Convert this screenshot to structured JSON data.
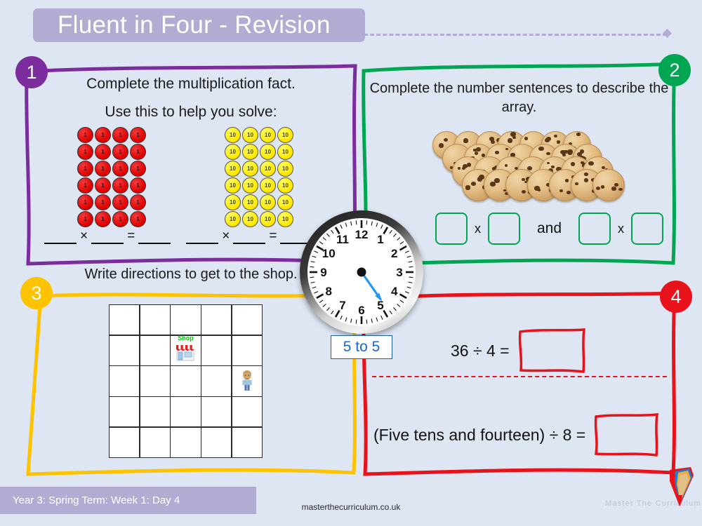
{
  "header": {
    "title": "Fluent in Four - Revision"
  },
  "panels": [
    {
      "number": "1",
      "color": "#7b2d9e",
      "heading": "Complete the multiplication fact.",
      "subheading": "Use this to help you solve:",
      "counters": {
        "ones_label": "1",
        "ones_rows": 6,
        "ones_cols": 4,
        "tens_label": "10",
        "tens_rows": 6,
        "tens_cols": 4
      },
      "sentence1": {
        "a": "____",
        "op": "×",
        "b": "____",
        "eq": "=",
        "c": "____"
      },
      "sentence2": {
        "a": "____",
        "op": "×",
        "b": "____",
        "eq": "=",
        "c": "____"
      }
    },
    {
      "number": "2",
      "color": "#00a651",
      "heading": "Complete the number sentences to describe the array.",
      "array": {
        "rows": 4,
        "cols": 7,
        "item": "cookie"
      },
      "multiply_label": "x",
      "and_label": "and",
      "boxes": [
        "",
        "",
        "",
        ""
      ]
    },
    {
      "number": "3",
      "color": "#fdc300",
      "heading": "Write directions to get to the shop.",
      "grid": {
        "rows": 5,
        "cols": 5
      },
      "shop": {
        "label": "Shop",
        "row": 2,
        "col": 3
      },
      "person": {
        "row": 3,
        "col": 5
      }
    },
    {
      "number": "4",
      "color": "#e8121a",
      "equation1": "36 ÷ 4 =",
      "equation2": "(Five tens and fourteen) ÷ 8 =",
      "answer1": "",
      "answer2": ""
    }
  ],
  "clock": {
    "numerals": [
      "1",
      "2",
      "3",
      "4",
      "5",
      "6",
      "7",
      "8",
      "9",
      "10",
      "11",
      "12"
    ],
    "label": "5 to 5",
    "hand_angle_deg": 145,
    "hand_color": "#2196f3"
  },
  "footer": {
    "banner": "Year 3: Spring Term: Week 1: Day 4",
    "url": "masterthecurriculum.co.uk",
    "brand": "Master  The  Curriculum"
  }
}
